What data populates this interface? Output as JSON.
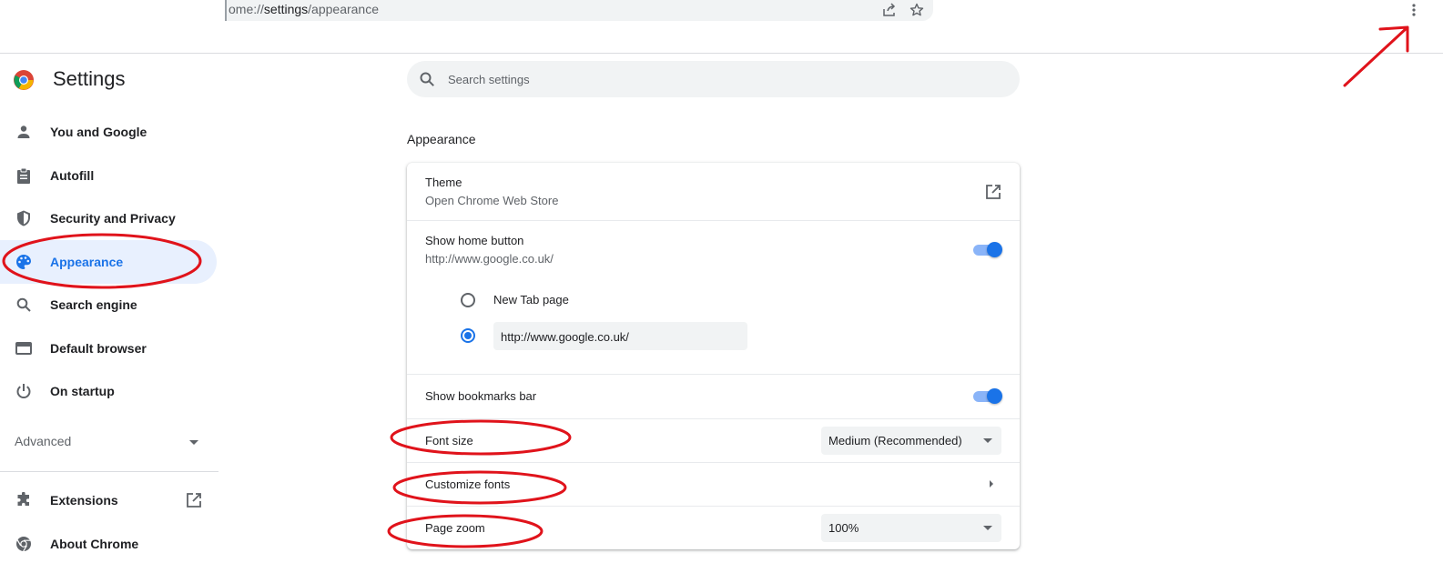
{
  "browser": {
    "url_prefix": "ome://",
    "url_host": "settings",
    "url_path": "/appearance",
    "icons": [
      "share-icon",
      "bookmark-star-icon",
      "more-vert-icon"
    ]
  },
  "sidebar": {
    "title": "Settings",
    "items": [
      {
        "label": "You and Google",
        "icon": "person-icon"
      },
      {
        "label": "Autofill",
        "icon": "clipboard-icon"
      },
      {
        "label": "Security and Privacy",
        "icon": "shield-icon"
      },
      {
        "label": "Appearance",
        "icon": "palette-icon",
        "active": true
      },
      {
        "label": "Search engine",
        "icon": "search-icon"
      },
      {
        "label": "Default browser",
        "icon": "browser-window-icon"
      },
      {
        "label": "On startup",
        "icon": "power-icon"
      }
    ],
    "advanced_label": "Advanced",
    "footer_items": [
      {
        "label": "Extensions",
        "icon": "puzzle-icon"
      },
      {
        "label": "About Chrome",
        "icon": "chrome-logo-icon"
      }
    ]
  },
  "search": {
    "placeholder": "Search settings"
  },
  "appearance": {
    "section_title": "Appearance",
    "theme": {
      "label": "Theme",
      "sublabel": "Open Chrome Web Store"
    },
    "home_button": {
      "label": "Show home button",
      "sublabel": "http://www.google.co.uk/",
      "enabled": true,
      "options": [
        {
          "label": "New Tab page",
          "selected": false
        },
        {
          "value": "http://www.google.co.uk/",
          "selected": true
        }
      ]
    },
    "bookmarks_bar": {
      "label": "Show bookmarks bar",
      "enabled": true
    },
    "font_size": {
      "label": "Font size",
      "value": "Medium (Recommended)"
    },
    "customize_fonts": {
      "label": "Customize fonts"
    },
    "page_zoom": {
      "label": "Page zoom",
      "value": "100%"
    }
  },
  "colors": {
    "accent": "#1a73e8",
    "active_nav_bg": "#e8f0fe",
    "annotation": "#e0131b"
  }
}
